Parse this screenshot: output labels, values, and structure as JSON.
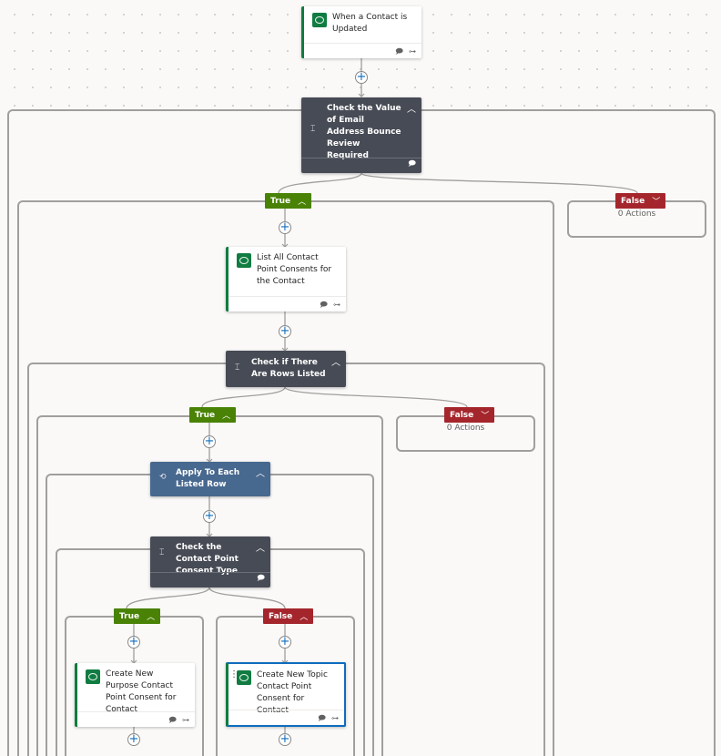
{
  "trigger": {
    "title": "When a Contact is Updated",
    "icon": "dataverse-icon",
    "footer_icons": [
      "comment-icon",
      "link-icon"
    ]
  },
  "condition1": {
    "title": "Check the Value of Email Address Bounce Review Required",
    "icon": "condition-icon",
    "collapse": "^",
    "footer_icon": "comment-icon",
    "true_label": "True",
    "false_label": "False",
    "false_summary": "0 Actions"
  },
  "list_action": {
    "title": "List All Contact Point Consents for the Contact",
    "icon": "dataverse-icon"
  },
  "condition2": {
    "title": "Check if There Are Rows Listed",
    "icon": "condition-icon",
    "true_label": "True",
    "false_label": "False",
    "false_summary": "0 Actions"
  },
  "loop": {
    "title": "Apply To Each Listed Row",
    "icon": "loop-icon"
  },
  "condition3": {
    "title": "Check the Contact Point Consent Type",
    "icon": "condition-icon",
    "true_label": "True",
    "false_label": "False"
  },
  "purpose_action": {
    "title": "Create New Purpose Contact Point Consent for Contact",
    "icon": "dataverse-icon"
  },
  "topic_action": {
    "title": "Create New Topic Contact Point Consent for Contact",
    "icon": "dataverse-icon",
    "selected": true
  },
  "glyphs": {
    "chevron_up": "︿",
    "chevron_down": "﹀",
    "plus": "+",
    "condition": "⌶",
    "loop": "⟲",
    "comment": "🗩",
    "link": "⊶",
    "drag": "⋮"
  },
  "colors": {
    "true_branch": "#498205",
    "false_branch": "#a4262c",
    "condition_bg": "#474b55",
    "loop_bg": "#47688f",
    "dataverse": "#107c41",
    "selected": "#0f6cbd"
  }
}
